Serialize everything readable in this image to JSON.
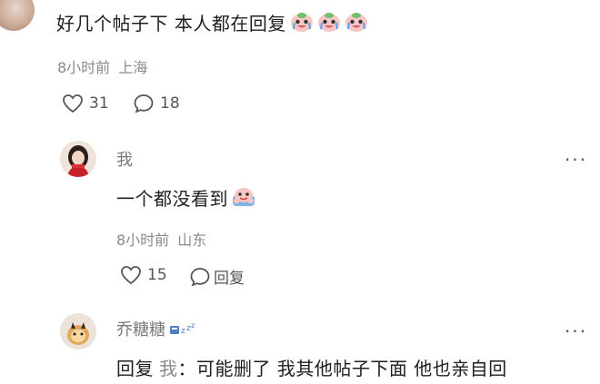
{
  "top_comment": {
    "text": "好几个帖子下 本人都在回复",
    "emoji_count": 3,
    "emoji_name": "crying-face-emoji",
    "time": "8小时前",
    "location": "上海",
    "likes": "31",
    "replies": "18"
  },
  "reply_me": {
    "username": "我",
    "text": "一个都没看到",
    "emoji_name": "hug-emoji",
    "time": "8小时前",
    "location": "山东",
    "likes": "15",
    "reply_label": "回复",
    "more_label": "···"
  },
  "reply_qtt": {
    "username": "乔糖糖",
    "badge_name": "sleeping-zzz-badge",
    "reply_prefix": "回复",
    "reply_to": "我",
    "separator": "：",
    "text": "可能删了 我其他帖子下面 他也亲自回",
    "more_label": "···"
  }
}
